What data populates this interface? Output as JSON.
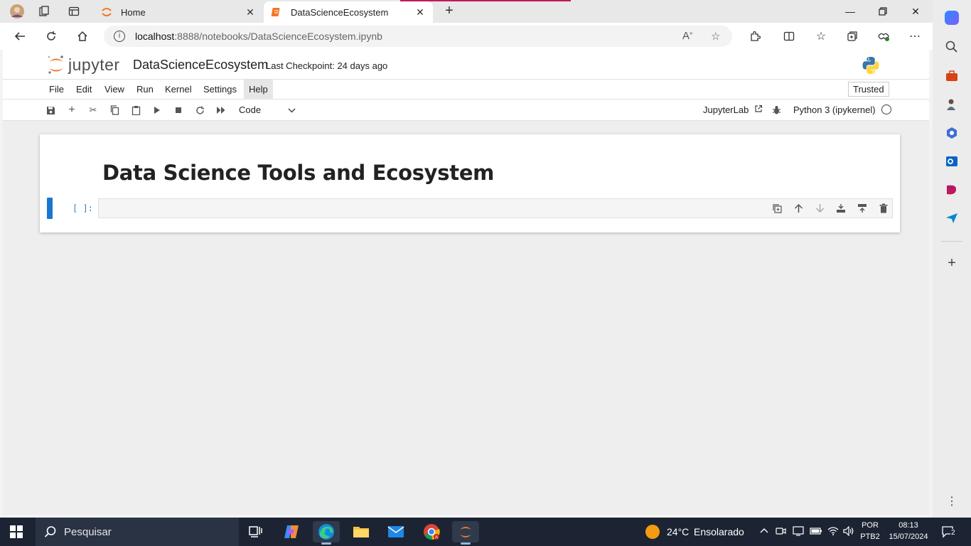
{
  "browser": {
    "tabs": [
      {
        "label": "Home",
        "active": false
      },
      {
        "label": "DataScienceEcosystem",
        "active": true
      }
    ],
    "url_host": "localhost",
    "url_path": ":8888/notebooks/DataScienceEcosystem.ipynb",
    "window_controls": [
      "minimize",
      "restore",
      "close"
    ]
  },
  "jupyter": {
    "logo_text": "jupyter",
    "notebook_name": "DataScienceEcosystem",
    "checkpoint": "Last Checkpoint: 24 days ago",
    "menu": [
      "File",
      "Edit",
      "View",
      "Run",
      "Kernel",
      "Settings",
      "Help"
    ],
    "trusted": "Trusted",
    "cell_type": "Code",
    "jupyterlab_link": "JupyterLab",
    "kernel": "Python 3 (ipykernel)"
  },
  "notebook": {
    "heading": "Data Science Tools and Ecosystem",
    "prompt": "[ ]:"
  },
  "taskbar": {
    "search_placeholder": "Pesquisar",
    "weather_temp": "24°C",
    "weather_desc": "Ensolarado",
    "lang_top": "POR",
    "lang_bottom": "PTB2",
    "time": "08:13",
    "date": "15/07/2024",
    "notifications": "2"
  },
  "colors": {
    "jupyter_orange": "#f37726",
    "cell_marker": "#1976d2",
    "prompt_blue": "#307fc1",
    "edge_accent": "#c2185b"
  }
}
